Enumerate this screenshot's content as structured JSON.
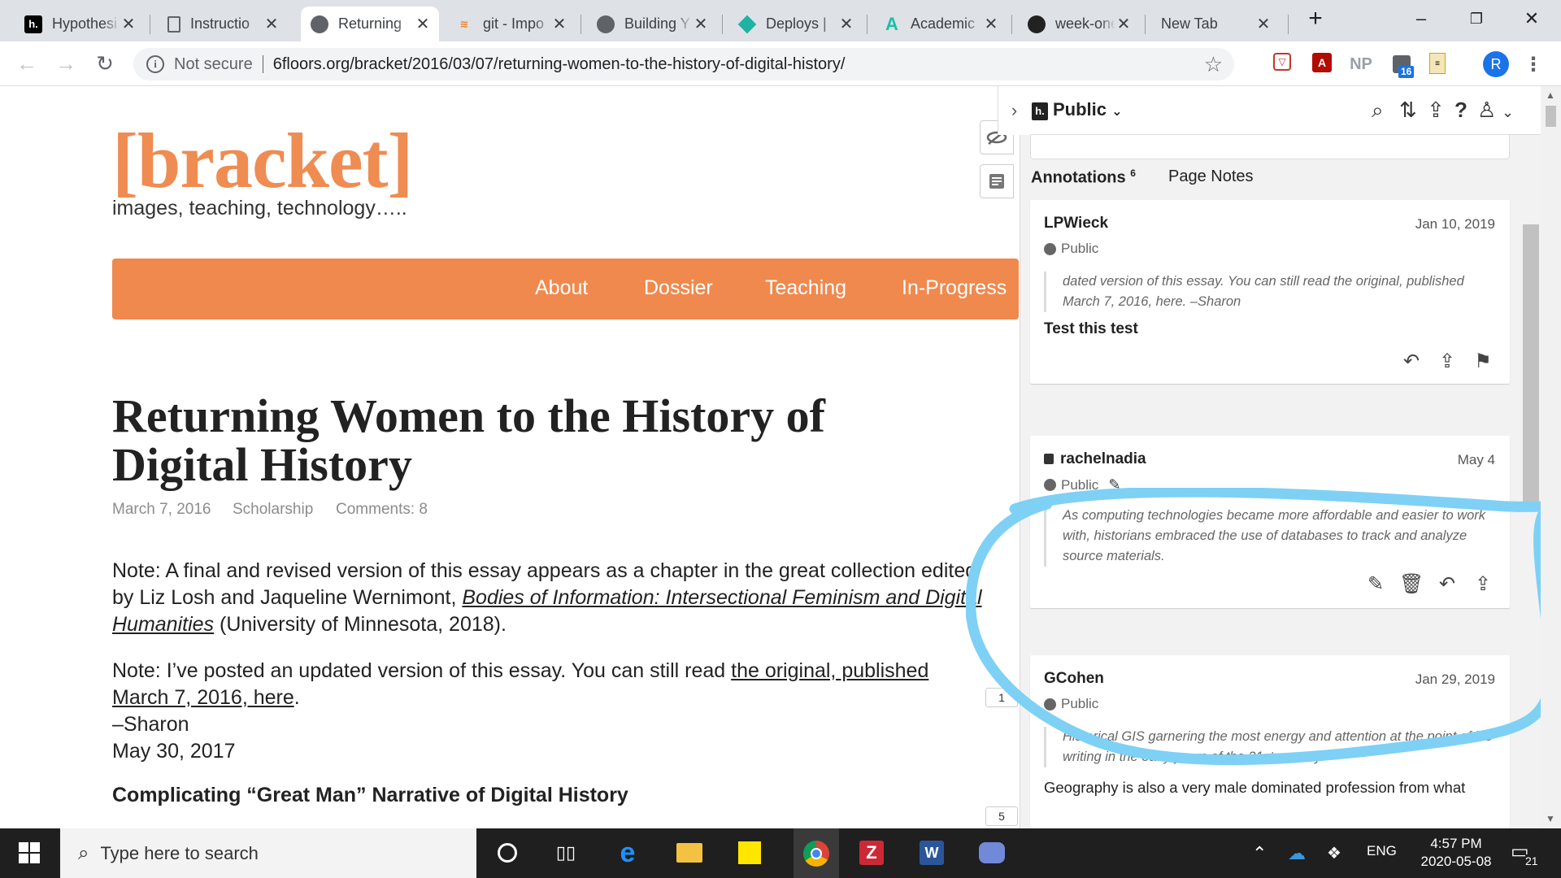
{
  "browser": {
    "tabs": [
      {
        "title": "Hypothesi",
        "favicon": "hypothesis-icon",
        "active": false
      },
      {
        "title": "Instructio",
        "favicon": "document-icon",
        "active": false
      },
      {
        "title": "Returning",
        "favicon": "globe-icon",
        "active": true
      },
      {
        "title": "git - Impo",
        "favicon": "stackoverflow-icon",
        "active": false
      },
      {
        "title": "Building Y",
        "favicon": "globe-icon",
        "active": false
      },
      {
        "title": "Deploys |",
        "favicon": "netlify-icon",
        "active": false
      },
      {
        "title": "Academic",
        "favicon": "academic-icon",
        "active": false
      },
      {
        "title": "week-one",
        "favicon": "github-icon",
        "active": false
      },
      {
        "title": "New Tab",
        "favicon": "",
        "active": false
      }
    ],
    "security": "Not secure",
    "url": "6floors.org/bracket/2016/03/07/returning-women-to-the-history-of-digital-history/",
    "profile_initial": "R",
    "ext_badge": "16",
    "ext_np": "NP"
  },
  "site": {
    "brand": "[bracket]",
    "tagline": "images, teaching, technology…..",
    "nav": [
      "About",
      "Dossier",
      "Teaching",
      "In-Progress"
    ]
  },
  "article": {
    "title": "Returning Women to the History of Digital History",
    "date": "March 7, 2016",
    "category": "Scholarship",
    "comments": "Comments: 8",
    "note1_pre": "Note: A final and revised version of this essay appears as a chapter in the great collection edited by Liz Losh and Jaqueline Wernimont, ",
    "note1_link": "Bodies of Information: Intersectional Feminism and Digital Humanities",
    "note1_post": " (University of Minnesota, 2018).",
    "note2_pre": "Note: I’ve posted an updated version of this essay. You can still read ",
    "note2_link": "the original, published March 7, 2016, here",
    "note2_post": ".",
    "signoff": "–Sharon",
    "signoff_date": "May 30, 2017",
    "section_heading": "Complicating “Great Man” Narrative of Digital History"
  },
  "sidebar": {
    "group": "Public",
    "tabs": {
      "annotations": "Annotations",
      "annotations_count": "6",
      "page_notes": "Page Notes"
    },
    "bucket_counts": [
      "1",
      "5"
    ],
    "annotations": [
      {
        "user": "LPWieck",
        "date": "Jan 10, 2019",
        "visibility": "Public",
        "quote": "dated version of this essay. You can still read the original, published March 7, 2016, here. –Sharon",
        "body": "Test this test"
      },
      {
        "user": "rachelnadia",
        "date": "May 4",
        "visibility": "Public",
        "quote": "As computing technologies became more affordable and easier to work with, historians embraced the use of databases to track and analyze source materials.",
        "body": ""
      },
      {
        "user": "GCohen",
        "date": "Jan 29, 2019",
        "visibility": "Public",
        "quote": "Historical GIS garnering the most energy and attention at the point of his writing in the early years of the 21st century.",
        "body": "Geography is also a very male dominated profession from what"
      }
    ]
  },
  "taskbar": {
    "search_placeholder": "Type here to search",
    "time": "4:57 PM",
    "date": "2020-05-08",
    "language": "ENG",
    "notifications": "21"
  },
  "colors": {
    "brand": "#ef8c52",
    "nav_bg": "#f0894e",
    "highlight": "#7fd0f5"
  }
}
